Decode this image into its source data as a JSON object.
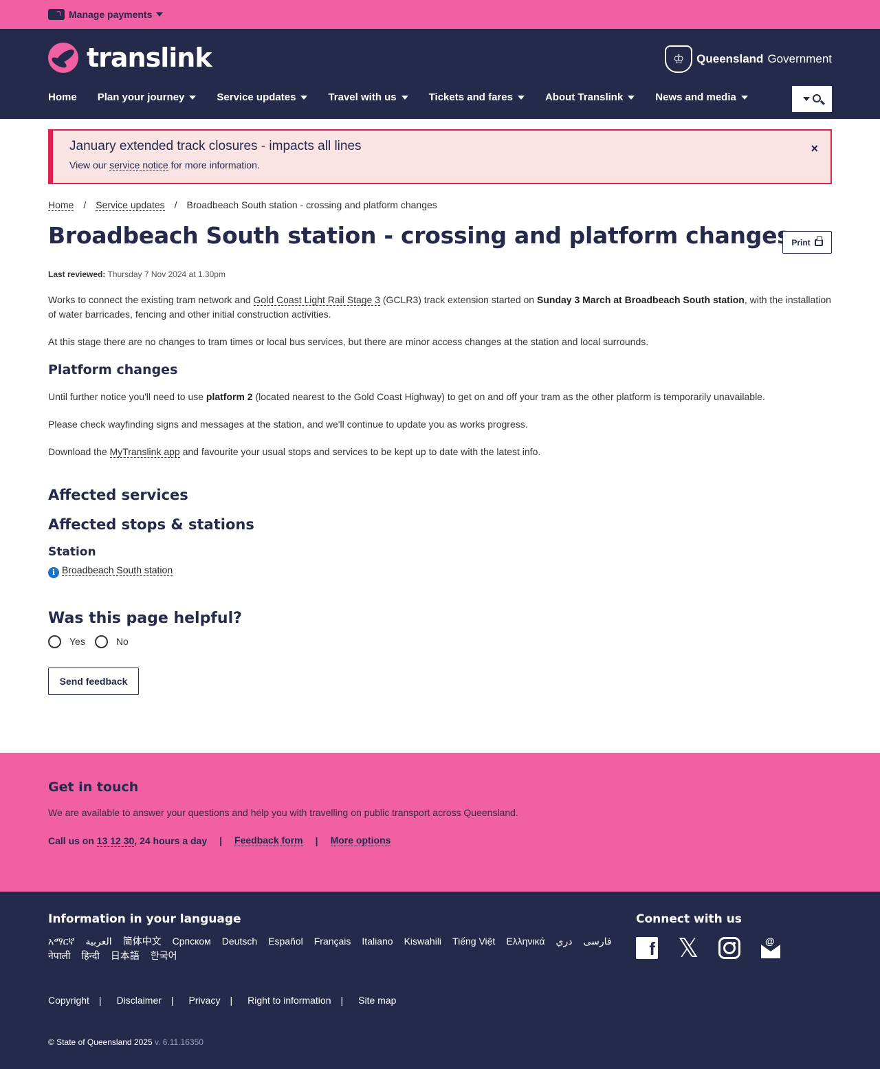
{
  "topbar": {
    "manage_payments": "Manage payments"
  },
  "header": {
    "logo_text": "translink",
    "qgov_bold": "Queensland",
    "qgov_rest": "Government",
    "nav": [
      "Home",
      "Plan your journey",
      "Service updates",
      "Travel with us",
      "Tickets and fares",
      "About Translink",
      "News and media"
    ]
  },
  "alert": {
    "title": "January extended track closures - impacts all lines",
    "text_before": "View our ",
    "link": "service notice",
    "text_after": " for more information.",
    "close": "×"
  },
  "breadcrumb": [
    "Home",
    "Service updates",
    "Broadbeach South station - crossing and platform changes"
  ],
  "page": {
    "title": "Broadbeach South station - crossing and platform changes",
    "print_label": "Print",
    "reviewed_label": "Last reviewed:",
    "reviewed_value": "Thursday 7 Nov 2024 at 1.30pm",
    "p1_a": "Works to connect the existing tram network and ",
    "p1_link": "Gold Coast Light Rail Stage 3",
    "p1_b": " (GCLR3) track extension started on ",
    "p1_bold": "Sunday 3 March at Broadbeach South station",
    "p1_c": ", with the installation of water barricades, fencing and other initial construction activities.",
    "p2": "At this stage there are no changes to tram times or local bus services, but there are minor access changes at the station and local surrounds.",
    "platform_heading": "Platform changes",
    "p3_a": "Until further notice you'll need to use ",
    "p3_bold": "platform 2",
    "p3_b": " (located nearest to the Gold Coast Highway) to get on and off your tram as the other platform is temporarily unavailable.",
    "p4": "Please check wayfinding signs and messages at the station, and we'll continue to update you as works progress.",
    "p5_a": "Download the ",
    "p5_link": "MyTranslink app",
    "p5_b": " and favourite your usual stops and services to be kept up to date with the latest info.",
    "affected_services": "Affected services",
    "affected_stops": "Affected stops & stations",
    "station_heading": "Station",
    "station_link": "Broadbeach South station"
  },
  "feedback": {
    "heading": "Was this page helpful?",
    "yes": "Yes",
    "no": "No",
    "send": "Send feedback"
  },
  "touch": {
    "heading": "Get in touch",
    "text": "We are available to answer your questions and help you with travelling on public transport across Queensland.",
    "call_prefix": "Call us on ",
    "phone": "13 12 30",
    "call_suffix": ", 24 hours a day",
    "feedback_form": "Feedback form",
    "more_options": "More options"
  },
  "footer": {
    "lang_heading": "Information in your language",
    "languages": [
      "አማርኛ",
      "العربية",
      "简体中文",
      "Српском",
      "Deutsch",
      "Español",
      "Français",
      "Italiano",
      "Kiswahili",
      "Tiếng Việt",
      "Ελληνικά",
      "دري",
      "فارسی",
      "नेपाली",
      "हिन्दी",
      "日本語",
      "한국어"
    ],
    "connect_heading": "Connect with us",
    "links": [
      "Copyright",
      "Disclaimer",
      "Privacy",
      "Right to information",
      "Site map"
    ],
    "copyright": "© State of Queensland 2025",
    "version": "v. 6.11.16350"
  },
  "colors": {
    "pink": "#f060a3",
    "navy": "#252a4a",
    "alert_red": "#e0204f",
    "alert_bg": "#f9e3e3"
  }
}
